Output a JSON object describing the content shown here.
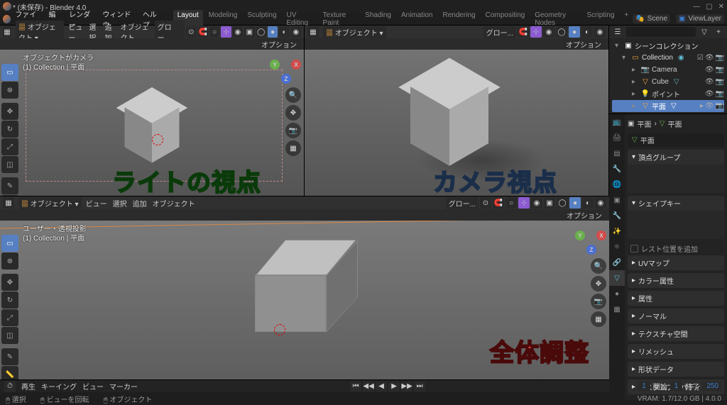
{
  "window": {
    "title": "* (未保存) - Blender 4.0"
  },
  "menu": [
    "ファイル",
    "編集",
    "レンダー",
    "ウィンドウ",
    "ヘルプ"
  ],
  "workspaces": [
    "Layout",
    "Modeling",
    "Sculpting",
    "UV Editing",
    "Texture Paint",
    "Shading",
    "Animation",
    "Rendering",
    "Compositing",
    "Geometry Nodes",
    "Scripting"
  ],
  "active_workspace": "Layout",
  "scene": {
    "label": "Scene",
    "layer": "ViewLayer"
  },
  "vp_header": {
    "mode": "オブジェクト",
    "menus": [
      "ビュー",
      "選択",
      "追加",
      "オブジェクト"
    ],
    "global": "グロー...",
    "options": "オプション"
  },
  "vp_add": "追加",
  "vp1_info": {
    "title": "オブジェクトがカメラ",
    "sub": "(1) Collection | 平面"
  },
  "vp3_info": {
    "title": "ユーザー・透視投影",
    "sub": "(1) Collection | 平面"
  },
  "annotations": {
    "light": "ライトの視点",
    "camera": "カメラ視点",
    "overall": "全体調整"
  },
  "outliner": {
    "title": "シーンコレクション",
    "collection": "Collection",
    "items": [
      "Camera",
      "Cube",
      "ポイント",
      "平面"
    ]
  },
  "properties": {
    "breadcrumb1": "平面",
    "breadcrumb2": "平面",
    "object_name": "平面",
    "vertex_groups": "頂点グループ",
    "shape_keys": "シェイプキー",
    "rest_pos": "レスト位置を追加",
    "panels": [
      "UVマップ",
      "カラー属性",
      "属性",
      "ノーマル",
      "テクスチャ空間",
      "リメッシュ",
      "形状データ",
      "カスタムプロパティ"
    ]
  },
  "timeline": {
    "menus": [
      "再生",
      "キーイング",
      "ビュー",
      "マーカー"
    ],
    "frame": "1",
    "start_lbl": "開始",
    "start": "1",
    "end_lbl": "終了",
    "end": "250"
  },
  "status": {
    "select": "選択",
    "rotate": "ビューを回転",
    "object": "オブジェクト",
    "vram": "VRAM: 1.7/12.0 GB | 4.0.0"
  }
}
